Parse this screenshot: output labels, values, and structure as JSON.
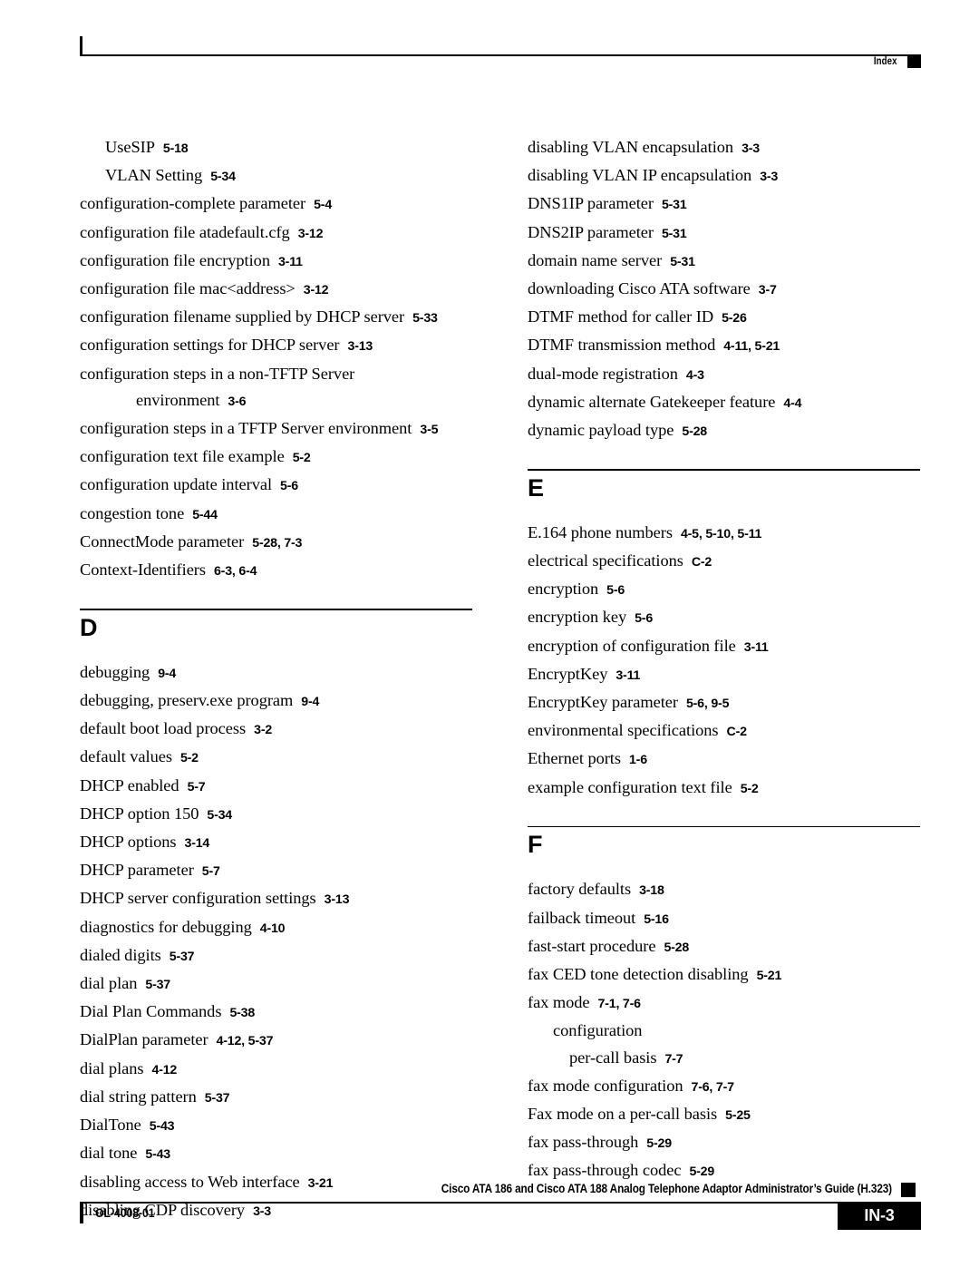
{
  "header": {
    "label": "Index"
  },
  "footer": {
    "guide_title": "Cisco ATA 186 and Cisco ATA 188 Analog Telephone Adaptor Administrator’s Guide (H.323)",
    "doc_id": "OL-4008-01",
    "page_number": "IN-3"
  },
  "columns": [
    {
      "id": "left",
      "blocks": [
        {
          "type": "entries",
          "entries": [
            {
              "level": 2,
              "term": "UseSIP",
              "locator": "5-18"
            },
            {
              "level": 2,
              "term": "VLAN Setting",
              "locator": "5-34"
            },
            {
              "level": 1,
              "term": "configuration-complete parameter",
              "locator": "5-4"
            },
            {
              "level": 1,
              "term": "configuration file atadefault.cfg",
              "locator": "3-12"
            },
            {
              "level": 1,
              "term": "configuration file encryption",
              "locator": "3-11"
            },
            {
              "level": 1,
              "term": "configuration file mac<address>",
              "locator": "3-12"
            },
            {
              "level": 1,
              "term": "configuration filename supplied by DHCP server",
              "locator": "5-33"
            },
            {
              "level": 1,
              "term": "configuration settings for DHCP server",
              "locator": "3-13"
            },
            {
              "level": 1,
              "term": "configuration steps in a non-TFTP Server",
              "locator": ""
            },
            {
              "level": 0,
              "term": "environment",
              "locator": "3-6"
            },
            {
              "level": 1,
              "term": "configuration steps in a TFTP Server environment",
              "locator": "3-5"
            },
            {
              "level": 1,
              "term": "configuration text file example",
              "locator": "5-2"
            },
            {
              "level": 1,
              "term": "configuration update interval",
              "locator": "5-6"
            },
            {
              "level": 1,
              "term": "congestion tone",
              "locator": "5-44"
            },
            {
              "level": 1,
              "term": "ConnectMode parameter",
              "locator": "5-28, 7-3"
            },
            {
              "level": 1,
              "term": "Context-Identifiers",
              "locator": "6-3, 6-4"
            }
          ]
        },
        {
          "type": "section",
          "letter": "D",
          "entries": [
            {
              "level": 1,
              "term": "debugging",
              "locator": "9-4"
            },
            {
              "level": 1,
              "term": "debugging, preserv.exe program",
              "locator": "9-4"
            },
            {
              "level": 1,
              "term": "default boot load process",
              "locator": "3-2"
            },
            {
              "level": 1,
              "term": "default values",
              "locator": "5-2"
            },
            {
              "level": 1,
              "term": "DHCP enabled",
              "locator": "5-7"
            },
            {
              "level": 1,
              "term": "DHCP option 150",
              "locator": "5-34"
            },
            {
              "level": 1,
              "term": "DHCP options",
              "locator": "3-14"
            },
            {
              "level": 1,
              "term": "DHCP parameter",
              "locator": "5-7"
            },
            {
              "level": 1,
              "term": "DHCP server configuration settings",
              "locator": "3-13"
            },
            {
              "level": 1,
              "term": "diagnostics for debugging",
              "locator": "4-10"
            },
            {
              "level": 1,
              "term": "dialed digits",
              "locator": "5-37"
            },
            {
              "level": 1,
              "term": "dial plan",
              "locator": "5-37"
            },
            {
              "level": 1,
              "term": "Dial Plan Commands",
              "locator": "5-38"
            },
            {
              "level": 1,
              "term": "DialPlan parameter",
              "locator": "4-12, 5-37"
            },
            {
              "level": 1,
              "term": "dial plans",
              "locator": "4-12"
            },
            {
              "level": 1,
              "term": "dial string pattern",
              "locator": "5-37"
            },
            {
              "level": 1,
              "term": "DialTone",
              "locator": "5-43"
            },
            {
              "level": 1,
              "term": "dial tone",
              "locator": "5-43"
            },
            {
              "level": 1,
              "term": "disabling access to Web interface",
              "locator": "3-21"
            },
            {
              "level": 1,
              "term": "disabling CDP discovery",
              "locator": "3-3"
            }
          ]
        }
      ]
    },
    {
      "id": "right",
      "blocks": [
        {
          "type": "entries",
          "entries": [
            {
              "level": 1,
              "term": "disabling VLAN encapsulation",
              "locator": "3-3"
            },
            {
              "level": 1,
              "term": "disabling VLAN IP encapsulation",
              "locator": "3-3"
            },
            {
              "level": 1,
              "term": "DNS1IP parameter",
              "locator": "5-31"
            },
            {
              "level": 1,
              "term": "DNS2IP parameter",
              "locator": "5-31"
            },
            {
              "level": 1,
              "term": "domain name server",
              "locator": "5-31"
            },
            {
              "level": 1,
              "term": "downloading Cisco ATA software",
              "locator": "3-7"
            },
            {
              "level": 1,
              "term": "DTMF method for caller ID",
              "locator": "5-26"
            },
            {
              "level": 1,
              "term": "DTMF transmission method",
              "locator": "4-11, 5-21"
            },
            {
              "level": 1,
              "term": "dual-mode registration",
              "locator": "4-3"
            },
            {
              "level": 1,
              "term": "dynamic alternate Gatekeeper feature",
              "locator": "4-4"
            },
            {
              "level": 1,
              "term": "dynamic payload type",
              "locator": "5-28"
            }
          ]
        },
        {
          "type": "section",
          "letter": "E",
          "entries": [
            {
              "level": 1,
              "term": "E.164 phone numbers",
              "locator": "4-5, 5-10, 5-11"
            },
            {
              "level": 1,
              "term": "electrical specifications",
              "locator": "C-2"
            },
            {
              "level": 1,
              "term": "encryption",
              "locator": "5-6"
            },
            {
              "level": 1,
              "term": "encryption key",
              "locator": "5-6"
            },
            {
              "level": 1,
              "term": "encryption of configuration file",
              "locator": "3-11"
            },
            {
              "level": 1,
              "term": "EncryptKey",
              "locator": "3-11"
            },
            {
              "level": 1,
              "term": "EncryptKey parameter",
              "locator": "5-6, 9-5"
            },
            {
              "level": 1,
              "term": "environmental specifications",
              "locator": "C-2"
            },
            {
              "level": 1,
              "term": "Ethernet ports",
              "locator": "1-6"
            },
            {
              "level": 1,
              "term": "example configuration text file",
              "locator": "5-2"
            }
          ]
        },
        {
          "type": "section",
          "letter": "F",
          "entries": [
            {
              "level": 1,
              "term": "factory defaults",
              "locator": "3-18"
            },
            {
              "level": 1,
              "term": "failback timeout",
              "locator": "5-16"
            },
            {
              "level": 1,
              "term": "fast-start procedure",
              "locator": "5-28"
            },
            {
              "level": 1,
              "term": "fax CED tone detection disabling",
              "locator": "5-21"
            },
            {
              "level": 1,
              "term": "fax mode",
              "locator": "7-1, 7-6"
            },
            {
              "level": 2,
              "term": "configuration",
              "locator": ""
            },
            {
              "level": 3,
              "term": "per-call basis",
              "locator": "7-7"
            },
            {
              "level": 1,
              "term": "fax mode configuration",
              "locator": "7-6, 7-7"
            },
            {
              "level": 1,
              "term": "Fax mode on a per-call basis",
              "locator": "5-25"
            },
            {
              "level": 1,
              "term": "fax pass-through",
              "locator": "5-29"
            },
            {
              "level": 1,
              "term": "fax pass-through codec",
              "locator": "5-29"
            }
          ]
        }
      ]
    }
  ]
}
